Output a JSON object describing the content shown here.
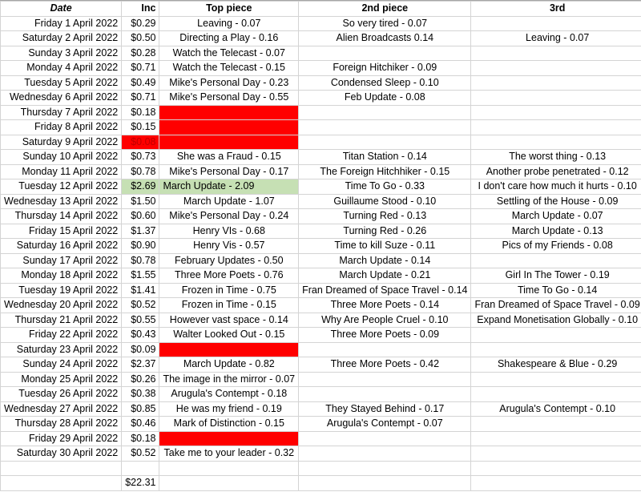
{
  "header": {
    "date": "Date",
    "inc": "Inc",
    "top": "Top piece",
    "second": "2nd piece",
    "third": "3rd"
  },
  "colors": {
    "red_highlight": "#ff0000",
    "green_highlight": "#c6e0b4"
  },
  "rows": [
    {
      "date": "Friday 1 April 2022",
      "inc": "$0.29",
      "top": "Leaving - 0.07",
      "second": "So very tired - 0.07",
      "third": ""
    },
    {
      "date": "Saturday 2 April 2022",
      "inc": "$0.50",
      "top": "Directing a Play - 0.16",
      "second": "Alien Broadcasts 0.14",
      "third": "Leaving - 0.07"
    },
    {
      "date": "Sunday 3 April 2022",
      "inc": "$0.28",
      "top": "Watch the Telecast - 0.07",
      "second": "",
      "third": ""
    },
    {
      "date": "Monday 4 April 2022",
      "inc": "$0.71",
      "top": "Watch the Telecast - 0.15",
      "second": "Foreign Hitchiker - 0.09",
      "third": ""
    },
    {
      "date": "Tuesday 5 April 2022",
      "inc": "$0.49",
      "top": "Mike's Personal Day - 0.23",
      "second": "Condensed Sleep - 0.10",
      "third": ""
    },
    {
      "date": "Wednesday 6 April 2022",
      "inc": "$0.71",
      "top": "Mike's Personal Day - 0.55",
      "second": "Feb Update - 0.08",
      "third": ""
    },
    {
      "date": "Thursday 7 April 2022",
      "inc": "$0.18",
      "top": "",
      "second": "",
      "third": "",
      "top_highlight": "red"
    },
    {
      "date": "Friday 8 April 2022",
      "inc": "$0.15",
      "top": "",
      "second": "",
      "third": "",
      "top_highlight": "red"
    },
    {
      "date": "Saturday 9 April 2022",
      "inc": "$0.08",
      "top": "",
      "second": "",
      "third": "",
      "top_highlight": "red",
      "inc_highlight": "red"
    },
    {
      "date": "Sunday 10 April 2022",
      "inc": "$0.73",
      "top": "She was a Fraud - 0.15",
      "second": "Titan Station - 0.14",
      "third": "The worst thing - 0.13"
    },
    {
      "date": "Monday 11 April 2022",
      "inc": "$0.78",
      "top": "Mike's Personal Day - 0.17",
      "second": "The Foreign Hitchhiker - 0.15",
      "third": "Another probe penetrated - 0.12"
    },
    {
      "date": "Tuesday 12 April 2022",
      "inc": "$2.69",
      "top": "March Update - 2.09",
      "second": "Time To Go - 0.33",
      "third": "I don't care how much it hurts - 0.10",
      "top_highlight": "green",
      "inc_highlight": "green"
    },
    {
      "date": "Wednesday 13 April 2022",
      "inc": "$1.50",
      "top": "March Update - 1.07",
      "second": "Guillaume Stood - 0.10",
      "third": "Settling of the House - 0.09"
    },
    {
      "date": "Thursday 14 April 2022",
      "inc": "$0.60",
      "top": "Mike's Personal Day - 0.24",
      "second": "Turning Red - 0.13",
      "third": "March Update - 0.07"
    },
    {
      "date": "Friday 15 April 2022",
      "inc": "$1.37",
      "top": "Henry VIs - 0.68",
      "second": "Turning Red - 0.26",
      "third": "March Update - 0.13"
    },
    {
      "date": "Saturday 16 April 2022",
      "inc": "$0.90",
      "top": "Henry Vis - 0.57",
      "second": "Time to kill Suze - 0.11",
      "third": "Pics of my Friends - 0.08"
    },
    {
      "date": "Sunday 17 April 2022",
      "inc": "$0.78",
      "top": "February Updates - 0.50",
      "second": "March Update - 0.14",
      "third": ""
    },
    {
      "date": "Monday 18 April 2022",
      "inc": "$1.55",
      "top": "Three More Poets - 0.76",
      "second": "March Update - 0.21",
      "third": "Girl In The Tower - 0.19"
    },
    {
      "date": "Tuesday 19 April 2022",
      "inc": "$1.41",
      "top": "Frozen in Time - 0.75",
      "second": "Fran Dreamed of Space Travel - 0.14",
      "third": "Time To Go - 0.14"
    },
    {
      "date": "Wednesday 20 April 2022",
      "inc": "$0.52",
      "top": "Frozen in Time - 0.15",
      "second": "Three More Poets - 0.14",
      "third": "Fran Dreamed of Space Travel - 0.09"
    },
    {
      "date": "Thursday 21 April 2022",
      "inc": "$0.55",
      "top": "However vast space - 0.14",
      "second": "Why Are People Cruel - 0.10",
      "third": "Expand Monetisation Globally - 0.10"
    },
    {
      "date": "Friday 22 April 2022",
      "inc": "$0.43",
      "top": "Walter Looked Out - 0.15",
      "second": "Three More Poets - 0.09",
      "third": ""
    },
    {
      "date": "Saturday 23 April 2022",
      "inc": "$0.09",
      "top": "",
      "second": "",
      "third": "",
      "top_highlight": "red"
    },
    {
      "date": "Sunday 24 April 2022",
      "inc": "$2.37",
      "top": "March Update - 0.82",
      "second": "Three More Poets - 0.42",
      "third": "Shakespeare & Blue - 0.29"
    },
    {
      "date": "Monday 25 April 2022",
      "inc": "$0.26",
      "top": "The image in the mirror - 0.07",
      "second": "",
      "third": ""
    },
    {
      "date": "Tuesday 26 April 2022",
      "inc": "$0.38",
      "top": "Arugula's Contempt - 0.18",
      "second": "",
      "third": ""
    },
    {
      "date": "Wednesday 27 April 2022",
      "inc": "$0.85",
      "top": "He was my friend - 0.19",
      "second": "They Stayed Behind - 0.17",
      "third": "Arugula's Contempt - 0.10"
    },
    {
      "date": "Thursday 28 April 2022",
      "inc": "$0.46",
      "top": "Mark of Distinction - 0.15",
      "second": "Arugula's Contempt - 0.07",
      "third": ""
    },
    {
      "date": "Friday 29 April 2022",
      "inc": "$0.18",
      "top": "",
      "second": "",
      "third": "",
      "top_highlight": "red"
    },
    {
      "date": "Saturday 30 April 2022",
      "inc": "$0.52",
      "top": "Take me to your leader - 0.32",
      "second": "",
      "third": ""
    }
  ],
  "total": {
    "label": "",
    "inc": "$22.31"
  }
}
